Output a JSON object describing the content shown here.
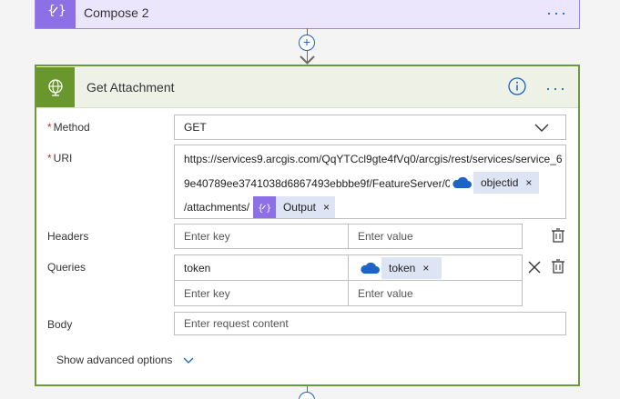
{
  "prev_action": {
    "title": "Compose 2",
    "icon": "compose-icon",
    "menu": "···"
  },
  "connector": {
    "plus": "+"
  },
  "action": {
    "title": "Get Attachment",
    "icon": "globe-icon",
    "menu": "···",
    "accent": "#69962d",
    "method": {
      "label": "Method",
      "required": "*",
      "value": "GET"
    },
    "uri": {
      "label": "URI",
      "required": "*",
      "line1": "https://services9.arcgis.com/QqYTCcl9gte4fVq0/arcgis/rest/services/service_6",
      "line2": "9e40789ee3741038d6867493ebbbe9f/FeatureServer/0/",
      "token1": "objectid",
      "line3": "/attachments/",
      "token2": "Output"
    },
    "headers": {
      "label": "Headers",
      "key_placeholder": "Enter key",
      "value_placeholder": "Enter value"
    },
    "queries": {
      "label": "Queries",
      "row1_key": "token",
      "row1_value_token": "token",
      "key_placeholder": "Enter key",
      "value_placeholder": "Enter value"
    },
    "body": {
      "label": "Body",
      "placeholder": "Enter request content"
    },
    "advanced": "Show advanced options",
    "token_remove": "×"
  }
}
